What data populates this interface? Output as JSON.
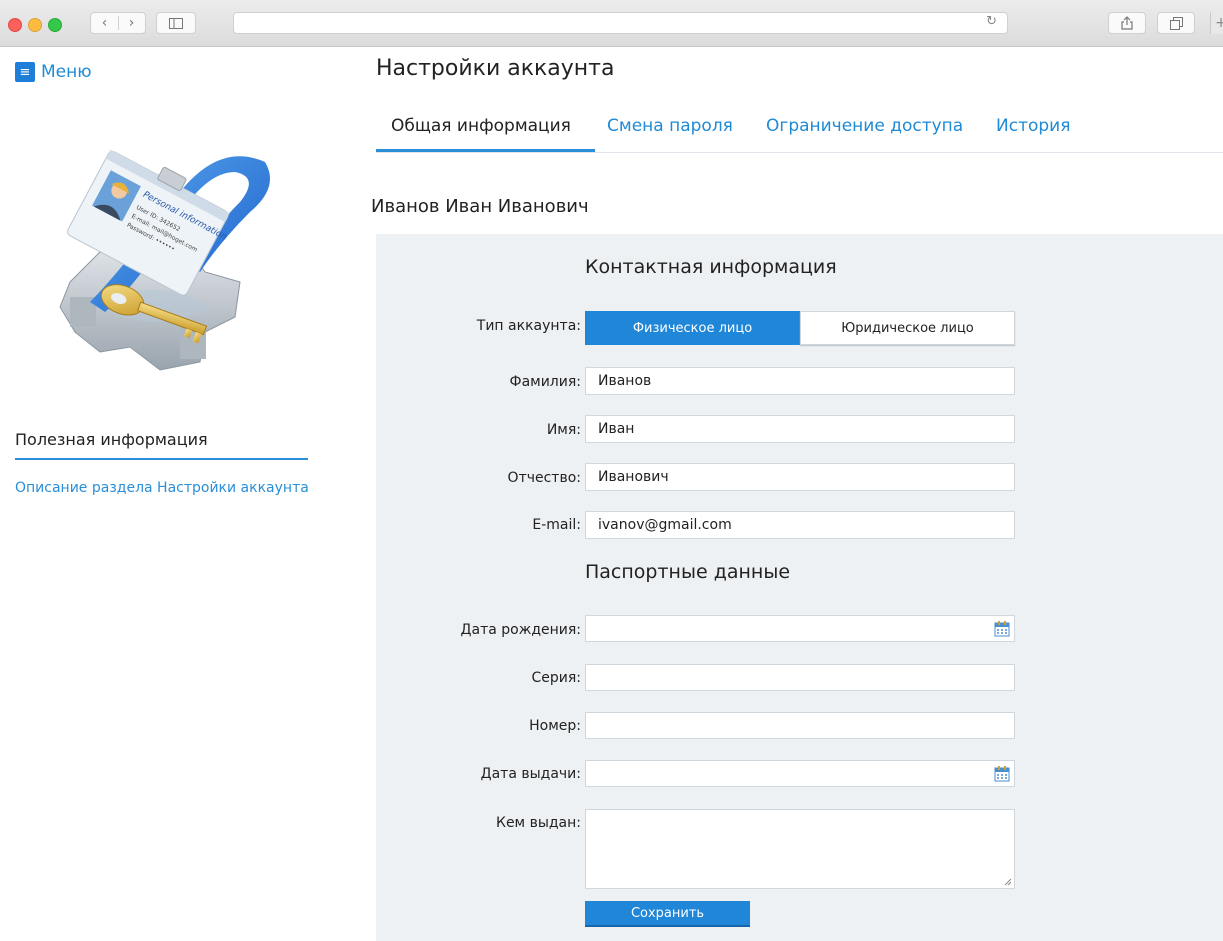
{
  "sidebar": {
    "menu_label": "Меню",
    "useful_title": "Полезная информация",
    "useful_link": "Описание раздела Настройки аккаунта",
    "illustration_badge": {
      "title": "Personal information",
      "line1": "User ID: 342652",
      "line2": "E-mail: mail@hoget.com",
      "line3": "Password: ••••••"
    }
  },
  "header": {
    "page_title": "Настройки аккаунта",
    "tabs": [
      {
        "label": "Общая информация",
        "active": true
      },
      {
        "label": "Смена пароля",
        "active": false
      },
      {
        "label": "Ограничение доступа",
        "active": false
      },
      {
        "label": "История",
        "active": false
      }
    ]
  },
  "user": {
    "full_name": "Иванов Иван Иванович"
  },
  "contact": {
    "section_title": "Контактная информация",
    "account_type_label": "Тип аккаунта:",
    "account_type_options": [
      "Физическое лицо",
      "Юридическое лицо"
    ],
    "account_type_selected": "Физическое лицо",
    "fields": {
      "last_name": {
        "label": "Фамилия:",
        "value": "Иванов"
      },
      "first_name": {
        "label": "Имя:",
        "value": "Иван"
      },
      "patronymic": {
        "label": "Отчество:",
        "value": "Иванович"
      },
      "email": {
        "label": "E-mail:",
        "value": "ivanov@gmail.com"
      }
    }
  },
  "passport": {
    "section_title": "Паспортные данные",
    "fields": {
      "birth_date": {
        "label": "Дата рождения:",
        "value": ""
      },
      "series": {
        "label": "Серия:",
        "value": ""
      },
      "number": {
        "label": "Номер:",
        "value": ""
      },
      "issue_date": {
        "label": "Дата выдачи:",
        "value": ""
      },
      "issued_by": {
        "label": "Кем выдан:",
        "value": ""
      }
    }
  },
  "actions": {
    "save_label": "Сохранить"
  },
  "colors": {
    "accent": "#1f86d8",
    "link": "#2a8fd8",
    "panel_bg": "#eef1f3"
  }
}
